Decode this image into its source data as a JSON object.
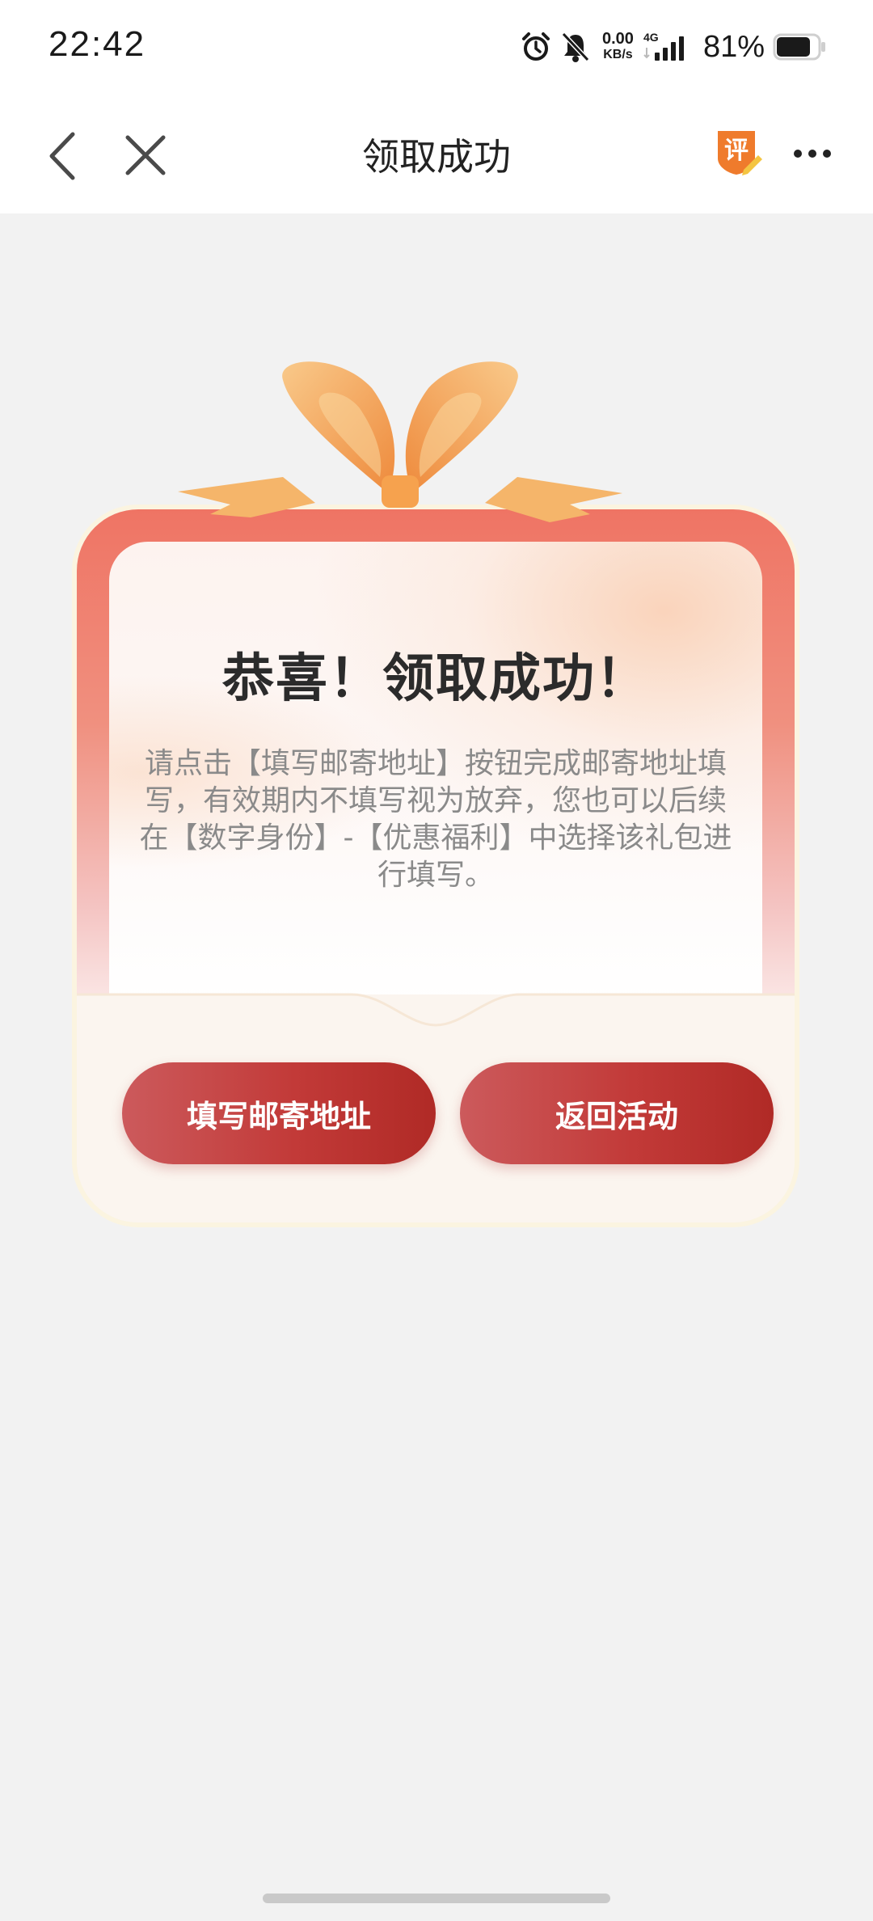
{
  "status_bar": {
    "time": "22:42",
    "net_speed_value": "0.00",
    "net_speed_unit": "KB/s",
    "network_type": "4G",
    "battery": "81%",
    "battery_level": 0.81,
    "icons": [
      "alarm-icon",
      "bell-muted-icon",
      "signal-icon",
      "battery-icon"
    ]
  },
  "nav": {
    "title": "领取成功",
    "review_badge": "评",
    "icons": [
      "back-icon",
      "close-icon",
      "review-icon",
      "more-icon"
    ]
  },
  "card": {
    "title": "恭喜！领取成功！",
    "description": "请点击【填写邮寄地址】按钮完成邮寄地址填写，有效期内不填写视为放弃，您也可以后续在【数字身份】-【优惠福利】中选择该礼包进行填写。",
    "buttons": {
      "fill_address": "填写邮寄地址",
      "back_to_activity": "返回活动"
    }
  },
  "colors": {
    "accent_red": "#c23a38",
    "ribbon_orange": "#f29a4a",
    "card_top": "#ef7464",
    "page_bg": "#f2f2f2"
  }
}
